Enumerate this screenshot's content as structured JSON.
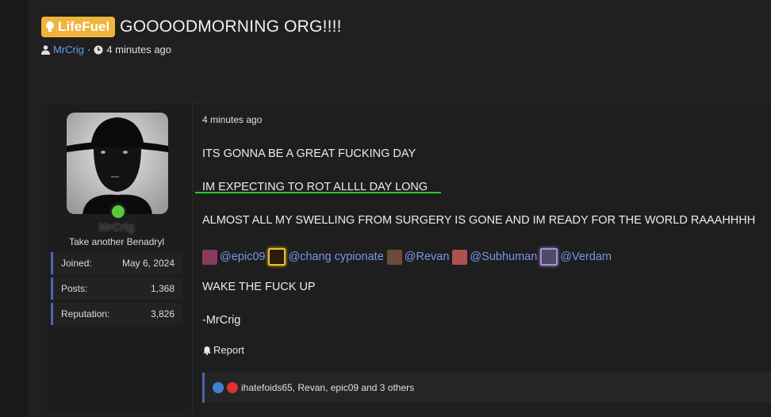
{
  "thread": {
    "prefix": "LifeFuel",
    "title": "GOOOODMORNING ORG!!!!",
    "author": "MrCrig",
    "time": "4 minutes ago",
    "separator": "·"
  },
  "post": {
    "author": {
      "username": "MrCrig",
      "user_title": "Take another Benadryl",
      "stats": [
        {
          "label": "Joined:",
          "value": "May 6, 2024"
        },
        {
          "label": "Posts:",
          "value": "1,368"
        },
        {
          "label": "Reputation:",
          "value": "3,826"
        }
      ]
    },
    "date": "4 minutes ago",
    "lines": [
      "ITS GONNA BE A GREAT FUCKING DAY",
      "IM EXPECTING TO ROT ALLLL DAY LONG",
      "ALMOST ALL MY SWELLING FROM SURGERY IS GONE AND IM READY FOR THE WORLD RAAAHHHH",
      "WAKE THE FUCK UP",
      "-MrCrig"
    ],
    "mentions": [
      {
        "name": "@epic09",
        "avatar_color": "#8a3a5a"
      },
      {
        "name": "@chang cypionate",
        "avatar_color": "#d4a020"
      },
      {
        "name": "@Revan",
        "avatar_color": "#6a4a3a"
      },
      {
        "name": "@Subhuman",
        "avatar_color": "#b05050"
      },
      {
        "name": "@Verdam",
        "avatar_color": "#4a4a6a"
      }
    ],
    "report_label": "Report",
    "reactions_text": "ihatefoids65, Revan, epic09 and 3 others"
  },
  "colors": {
    "accent": "#5560b0",
    "link": "#5aa0e6",
    "mention": "#7a96e8",
    "prefix_bg": "#f0b43c",
    "online": "#5cc83c",
    "highlight": "#22cc22"
  },
  "icons": [
    "lightbulb-icon",
    "user-icon",
    "clock-icon",
    "bell-icon",
    "like-icon",
    "love-icon"
  ]
}
